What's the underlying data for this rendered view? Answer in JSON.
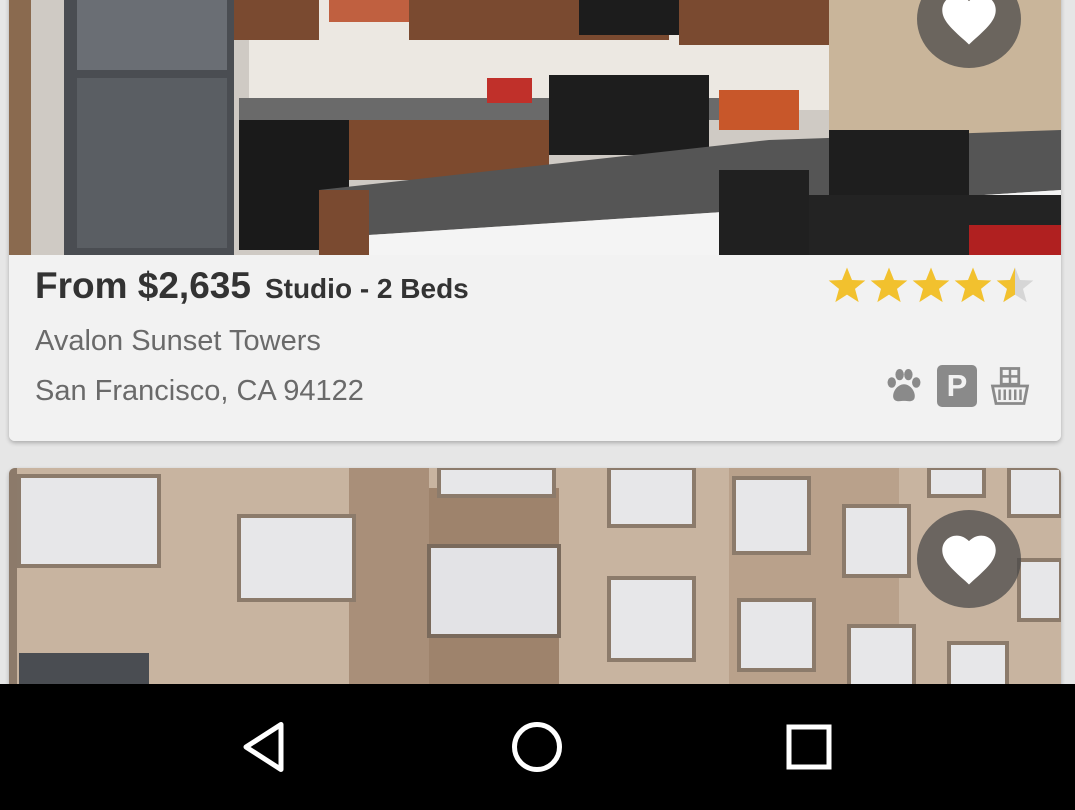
{
  "listings": [
    {
      "price": "From $2,635",
      "beds": "Studio - 2 Beds",
      "name": "Avalon Sunset Towers",
      "address": "San Francisco, CA 94122",
      "rating": 4.5,
      "rating_max": 5,
      "amenities": [
        "paw-icon",
        "parking-icon",
        "washer-icon"
      ],
      "parking_label": "P",
      "photo": "kitchen-photo",
      "favorite_icon": "heart-icon"
    },
    {
      "photo": "building-exterior-photo",
      "favorite_icon": "heart-icon"
    }
  ],
  "navbar": {
    "buttons": [
      "back-icon",
      "home-icon",
      "recents-icon"
    ]
  },
  "colors": {
    "star": "#f2c12e",
    "star_empty": "#d6d6d6",
    "amenity": "#8a8a8a",
    "navbar": "#000000",
    "card": "#f2f2f2"
  }
}
